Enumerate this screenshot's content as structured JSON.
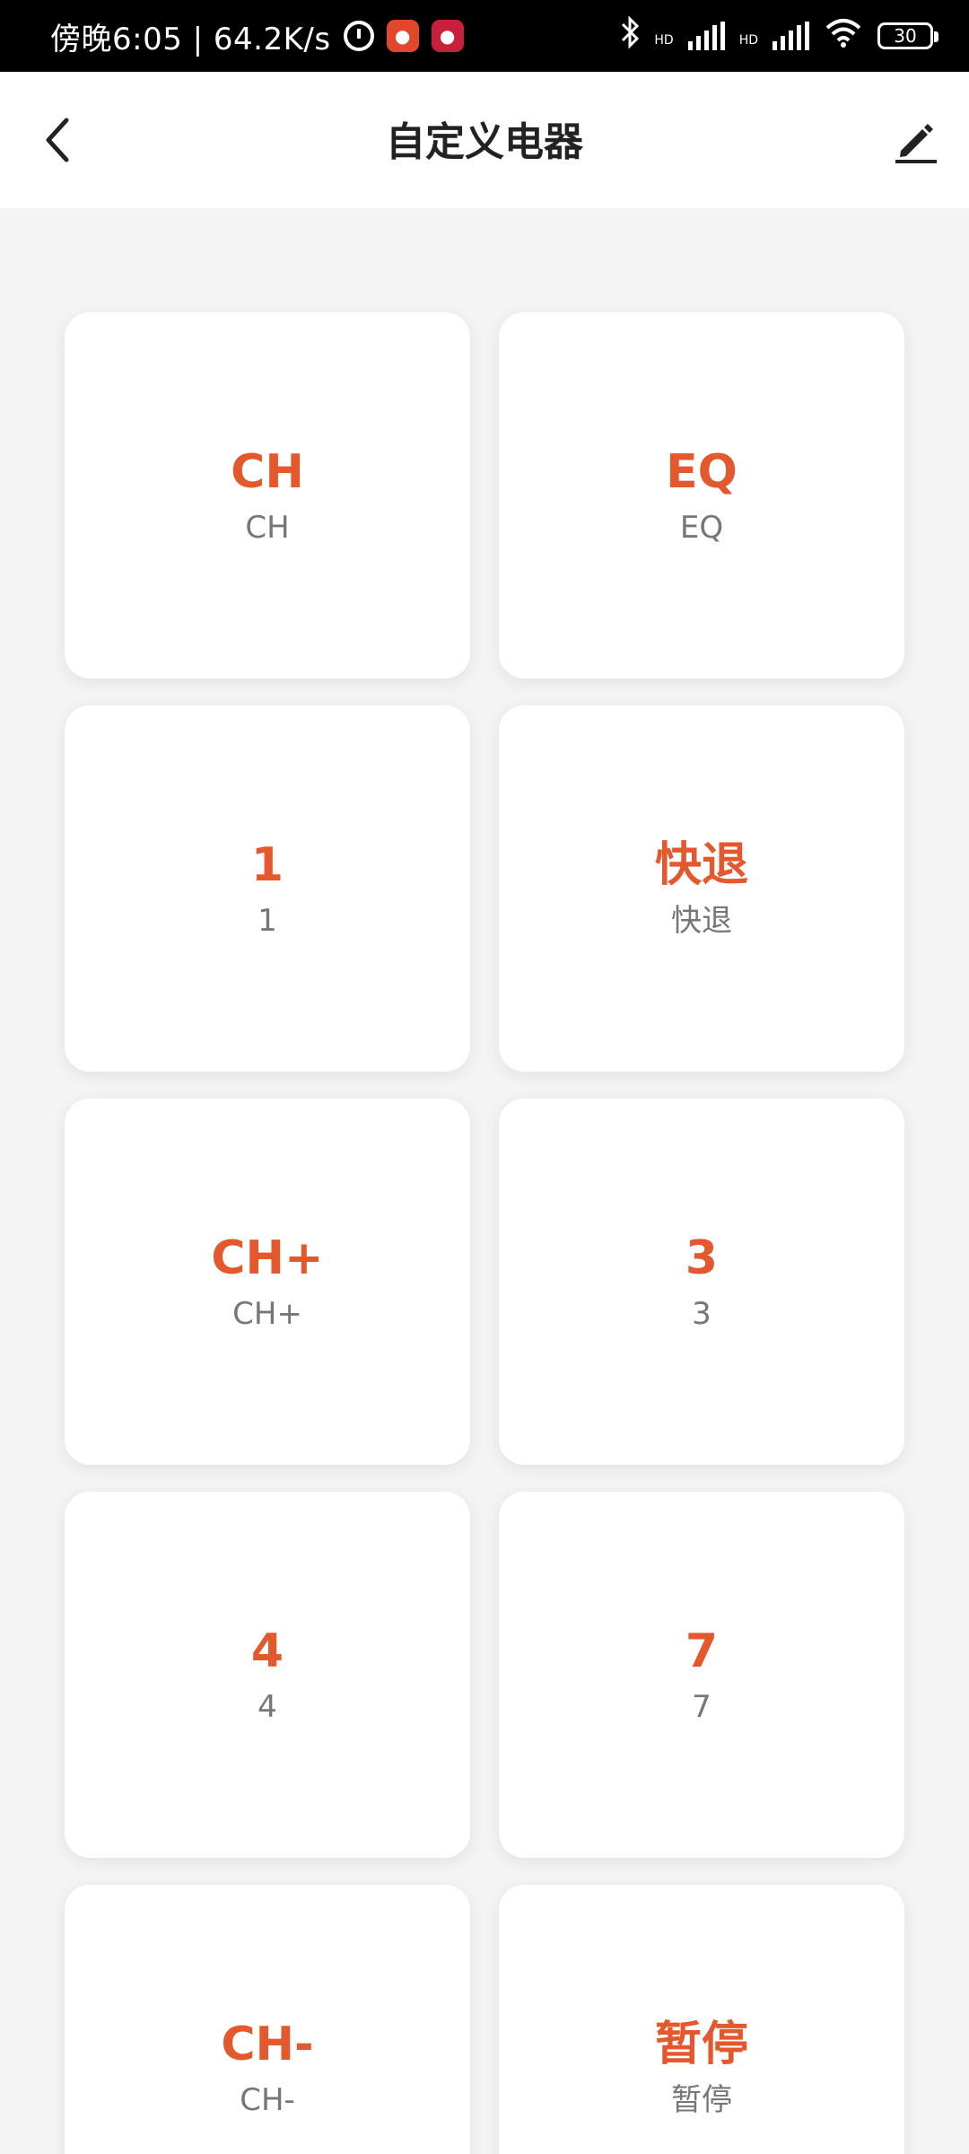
{
  "status_bar": {
    "time_text": "傍晚6:05 | 64.2K/s",
    "hd1": "HD",
    "hd2": "HD",
    "battery": "30",
    "icons": [
      "alarm-icon",
      "app-icon",
      "app-icon",
      "bluetooth-icon",
      "signal-icon",
      "signal-icon",
      "wifi-icon",
      "battery-icon"
    ]
  },
  "header": {
    "title": "自定义电器",
    "back_icon": "chevron-left-icon",
    "edit_icon": "pencil-icon"
  },
  "keys": [
    {
      "main": "CH",
      "sub": "CH"
    },
    {
      "main": "EQ",
      "sub": "EQ"
    },
    {
      "main": "1",
      "sub": "1"
    },
    {
      "main": "快退",
      "sub": "快退"
    },
    {
      "main": "CH+",
      "sub": "CH+"
    },
    {
      "main": "3",
      "sub": "3"
    },
    {
      "main": "4",
      "sub": "4"
    },
    {
      "main": "7",
      "sub": "7"
    },
    {
      "main": "CH-",
      "sub": "CH-"
    },
    {
      "main": "暂停",
      "sub": "暂停"
    }
  ],
  "colors": {
    "accent": "#e3582c",
    "sub_text": "#777777",
    "background": "#f4f4f4"
  }
}
